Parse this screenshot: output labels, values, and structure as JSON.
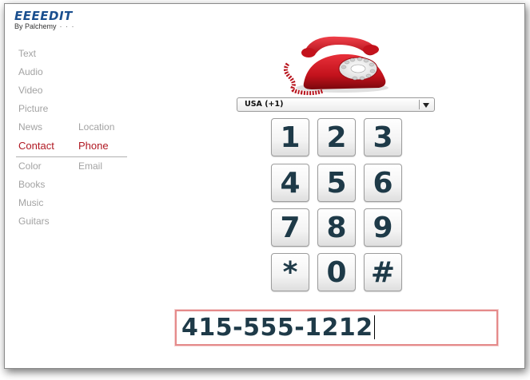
{
  "app": {
    "logo": "EEEEDIT",
    "byline": "By Palchemy",
    "byline_dots": "· · ·"
  },
  "nav": {
    "left": [
      "Text",
      "Audio",
      "Video",
      "Picture",
      "News",
      "Contact",
      "Color",
      "Books",
      "Music",
      "Guitars"
    ],
    "right": [
      "Location",
      "Phone",
      "Email"
    ],
    "active_left": "Contact",
    "active_right": "Phone"
  },
  "phone_image": {
    "icon": "red-rotary-telephone"
  },
  "country_select": {
    "value": "USA (+1)"
  },
  "keypad": {
    "keys": [
      "1",
      "2",
      "3",
      "4",
      "5",
      "6",
      "7",
      "8",
      "9",
      "*",
      "0",
      "#"
    ]
  },
  "number_field": {
    "value": "415-555-1212"
  },
  "colors": {
    "accent": "#b01822",
    "logo": "#1a4f8f",
    "digits": "#1e3a48",
    "field_border": "#e58b8b"
  }
}
